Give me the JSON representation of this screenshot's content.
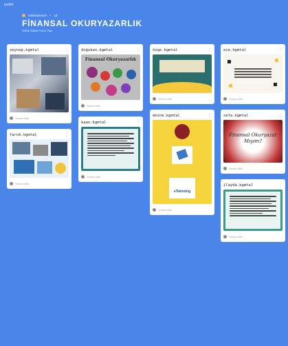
{
  "app": {
    "logo": "padlet"
  },
  "header": {
    "author": "habitsdeutsch",
    "separator": "•",
    "age": "1d",
    "title": "FİNANSAL OKURYAZARLIK",
    "subtitle": "Ortak Dijital Pano Yap"
  },
  "footer_label": "Yorum ekle",
  "colors": {
    "background": "#4a86ea",
    "card": "#ffffff"
  },
  "columns": [
    {
      "cards": [
        {
          "author": "zeynep.kgmtal"
        },
        {
          "author": "faruk.kgmtal"
        }
      ]
    },
    {
      "cards": [
        {
          "author": "doğukan.kgmtal",
          "thumb_title": "Finansal Okuryazarlık"
        },
        {
          "author": "kaan.kgmtal"
        }
      ]
    },
    {
      "cards": [
        {
          "author": "özge.kgmtal"
        },
        {
          "author": "emine.kgmtal",
          "thumb_text": "eTwinning"
        }
      ]
    },
    {
      "cards": [
        {
          "author": "ece.kgmtal"
        },
        {
          "author": "sefa.kgmtal",
          "thumb_title": "Finansal Okuryazar Mıyım?"
        },
        {
          "author": "ilayda.kgmtal"
        }
      ]
    }
  ]
}
